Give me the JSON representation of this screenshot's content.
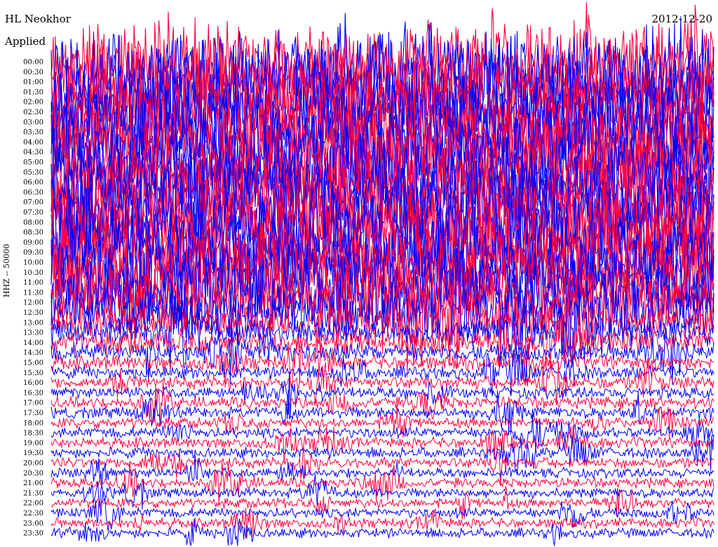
{
  "header": {
    "station": "HL Neokhor",
    "filter": "Applied",
    "date": "2012-12-20"
  },
  "chart_data": {
    "type": "line",
    "ylabel": "HHZ -- 50000",
    "colors": [
      "#ff0040",
      "#0000ff"
    ],
    "tick_labels": [
      "00:00",
      "00:30",
      "01:00",
      "01:30",
      "02:00",
      "02:30",
      "03:00",
      "03:30",
      "04:00",
      "04:30",
      "05:00",
      "05:30",
      "06:00",
      "06:30",
      "07:00",
      "07:30",
      "08:00",
      "08:30",
      "09:00",
      "09:30",
      "10:00",
      "10:30",
      "11:00",
      "11:30",
      "12:00",
      "12:30",
      "13:00",
      "13:30",
      "14:00",
      "14:30",
      "15:00",
      "15:30",
      "16:00",
      "16:30",
      "17:00",
      "17:30",
      "18:00",
      "18:30",
      "19:00",
      "19:30",
      "20:00",
      "20:30",
      "21:00",
      "21:30",
      "22:00",
      "22:30",
      "23:00",
      "23:30"
    ],
    "amplitude": [
      9,
      9,
      9,
      9,
      9,
      9,
      9,
      9,
      9,
      9,
      9,
      9,
      9,
      9,
      9,
      9,
      9,
      9,
      9,
      9,
      8.5,
      8,
      8,
      7.5,
      7,
      6,
      3.5,
      3,
      2.5,
      2,
      1.6,
      1.4,
      1.4,
      1.3,
      1.3,
      1.3,
      1.2,
      1.2,
      1.2,
      1.2,
      1.2,
      1.1,
      1.1,
      1.1,
      1.1,
      1.1,
      1.1,
      1.1
    ]
  }
}
